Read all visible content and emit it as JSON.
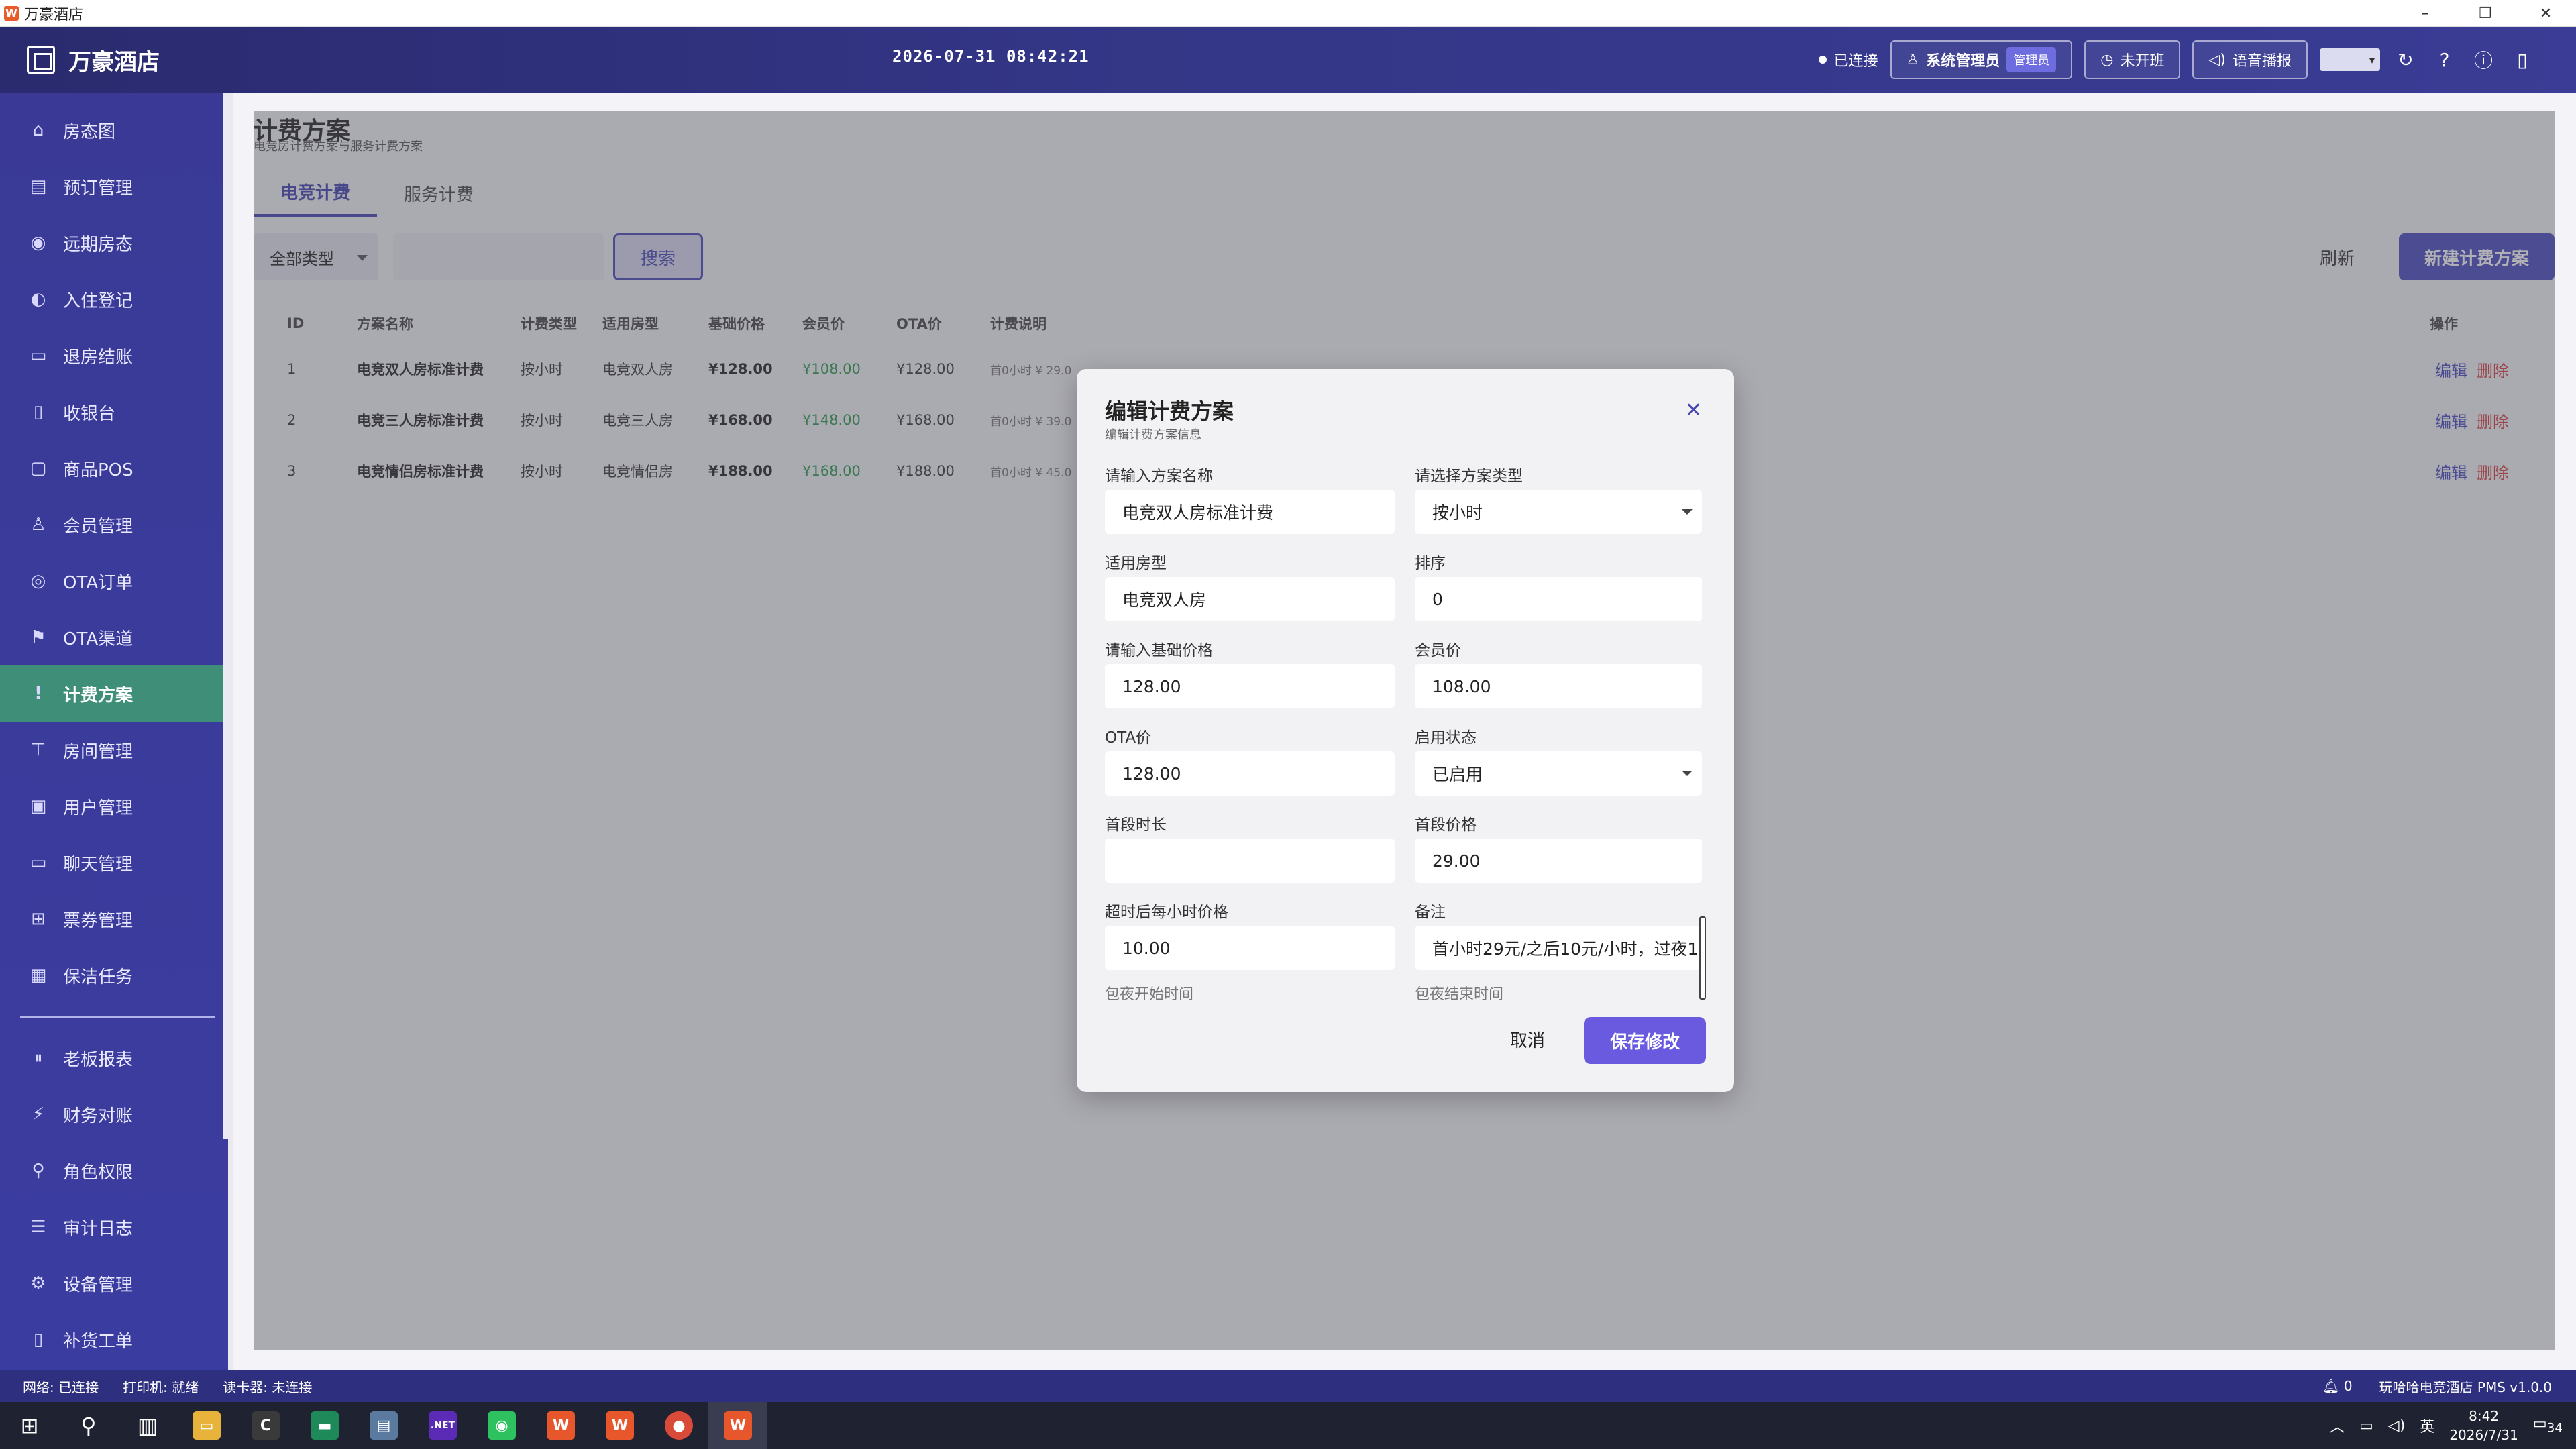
{
  "window": {
    "title": "万豪酒店",
    "app_icon": "W"
  },
  "header": {
    "brand": "万豪酒店",
    "datetime": "2026-07-31 08:42:21",
    "connection": "已连接",
    "user_label": "系统管理员",
    "role_badge": "管理员",
    "shift_label": "未开班",
    "voice_label": "语音播报"
  },
  "sidebar": {
    "items": [
      {
        "label": "房态图",
        "icon": "⌂"
      },
      {
        "label": "预订管理",
        "icon": "▤"
      },
      {
        "label": "远期房态",
        "icon": "◉"
      },
      {
        "label": "入住登记",
        "icon": "◐"
      },
      {
        "label": "退房结账",
        "icon": "▭"
      },
      {
        "label": "收银台",
        "icon": "▯"
      },
      {
        "label": "商品POS",
        "icon": "▢"
      },
      {
        "label": "会员管理",
        "icon": "♙"
      },
      {
        "label": "OTA订单",
        "icon": "◎"
      },
      {
        "label": "OTA渠道",
        "icon": "⚑"
      },
      {
        "label": "计费方案",
        "icon": "!"
      },
      {
        "label": "房间管理",
        "icon": "⊤"
      },
      {
        "label": "用户管理",
        "icon": "▣"
      },
      {
        "label": "聊天管理",
        "icon": "▭"
      },
      {
        "label": "票券管理",
        "icon": "⊞"
      },
      {
        "label": "保洁任务",
        "icon": "▦"
      }
    ],
    "items2": [
      {
        "label": "老板报表",
        "icon": "⏸"
      },
      {
        "label": "财务对账",
        "icon": "⚡"
      },
      {
        "label": "角色权限",
        "icon": "⚲"
      },
      {
        "label": "审计日志",
        "icon": "☰"
      },
      {
        "label": "设备管理",
        "icon": "⚙"
      },
      {
        "label": "补货工单",
        "icon": "▯"
      }
    ]
  },
  "page": {
    "title": "计费方案",
    "subtitle": "电竞房计费方案与服务计费方案",
    "tabs": [
      "电竞计费",
      "服务计费"
    ],
    "type_filter": "全部类型",
    "search_button": "搜索",
    "refresh_button": "刷新",
    "new_button": "新建计费方案"
  },
  "table": {
    "headers": [
      "ID",
      "方案名称",
      "计费类型",
      "适用房型",
      "基础价格",
      "会员价",
      "OTA价",
      "计费说明",
      "操作"
    ],
    "rows": [
      {
        "id": "1",
        "name": "电竞双人房标准计费",
        "type": "按小时",
        "room": "电竞双人房",
        "base": "¥128.00",
        "member": "¥108.00",
        "ota": "¥128.00",
        "desc": "首0小时 ¥ 29.0"
      },
      {
        "id": "2",
        "name": "电竞三人房标准计费",
        "type": "按小时",
        "room": "电竞三人房",
        "base": "¥168.00",
        "member": "¥148.00",
        "ota": "¥168.00",
        "desc": "首0小时 ¥ 39.0"
      },
      {
        "id": "3",
        "name": "电竞情侣房标准计费",
        "type": "按小时",
        "room": "电竞情侣房",
        "base": "¥188.00",
        "member": "¥168.00",
        "ota": "¥188.00",
        "desc": "首0小时 ¥ 45.0"
      }
    ],
    "edit_label": "编辑",
    "delete_label": "删除"
  },
  "modal": {
    "title": "编辑计费方案",
    "subtitle": "编辑计费方案信息",
    "fields": {
      "name_label": "请输入方案名称",
      "name_value": "电竞双人房标准计费",
      "type_label": "请选择方案类型",
      "type_value": "按小时",
      "room_label": "适用房型",
      "room_value": "电竞双人房",
      "sort_label": "排序",
      "sort_value": "0",
      "base_label": "请输入基础价格",
      "base_value": "128.00",
      "member_label": "会员价",
      "member_value": "108.00",
      "ota_label": "OTA价",
      "ota_value": "128.00",
      "status_label": "启用状态",
      "status_value": "已启用",
      "first_dur_label": "首段时长",
      "first_dur_value": "",
      "first_price_label": "首段价格",
      "first_price_value": "29.00",
      "overtime_label": "超时后每小时价格",
      "overtime_value": "10.00",
      "note_label": "备注",
      "note_value": "首小时29元/之后10元/小时，过夜1",
      "faded_left": "包夜开始时间",
      "faded_right": "包夜结束时间"
    },
    "cancel": "取消",
    "save": "保存修改"
  },
  "statusbar": {
    "network": "网络: 已连接",
    "printer": "打印机: 就绪",
    "reader": "读卡器: 未连接",
    "notif_count": "0",
    "version": "玩哈哈电竞酒店 PMS v1.0.0"
  },
  "taskbar": {
    "ime": "英",
    "time": "8:42",
    "date": "2026/7/31",
    "notif": "34"
  }
}
